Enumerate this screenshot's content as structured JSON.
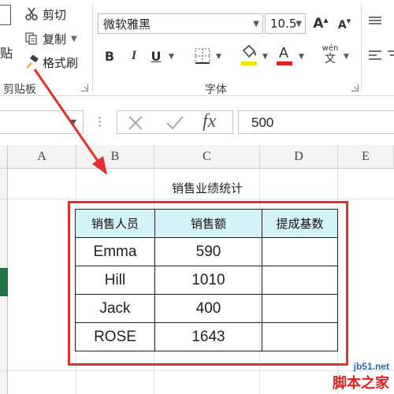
{
  "ribbon": {
    "clipboard": {
      "paste_label": "贴",
      "cut_label": "剪切",
      "copy_label": "复制",
      "format_painter_label": "格式刷",
      "group_label": "剪贴板"
    },
    "font": {
      "font_name": "微软雅黑",
      "font_size": "10.5",
      "grow_label": "A",
      "shrink_label": "A",
      "bold_label": "B",
      "italic_label": "I",
      "underline_label": "U",
      "phonetic_label": "wén",
      "phonetic_sub": "文",
      "group_label": "字体",
      "font_color_hex": "#e02020",
      "fill_color_hex": "#f5e000"
    }
  },
  "formula_bar": {
    "fx_label": "fx",
    "value": "500"
  },
  "columns": [
    "A",
    "B",
    "C",
    "D",
    "E"
  ],
  "sheet": {
    "title": "销售业绩统计",
    "headers": [
      "销售人员",
      "销售额",
      "提成基数"
    ],
    "header_fill_hex": "#d4f3f7",
    "rows": [
      {
        "name": "Emma",
        "sales": "590",
        "commission": ""
      },
      {
        "name": "Hill",
        "sales": "1010",
        "commission": ""
      },
      {
        "name": "Jack",
        "sales": "400",
        "commission": ""
      },
      {
        "name": "ROSE",
        "sales": "1643",
        "commission": ""
      }
    ]
  },
  "annotation": {
    "color_hex": "#e03030",
    "icon": "red-arrow-icon"
  },
  "watermark": {
    "url": "jb51.net",
    "name": "脚本之家"
  }
}
